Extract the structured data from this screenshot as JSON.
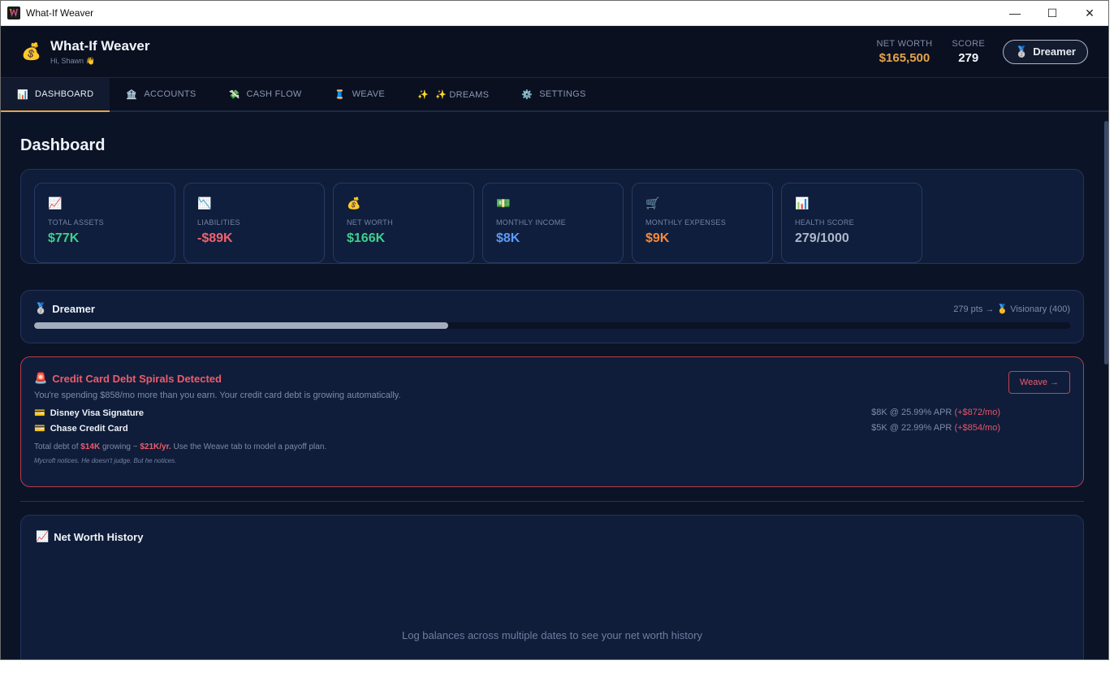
{
  "window": {
    "title": "What-If Weaver",
    "minimize": "—",
    "maximize": "☐",
    "close": "✕"
  },
  "header": {
    "logo_emoji": "💰",
    "app_name": "What-If Weaver",
    "greeting": "Hi, Shawn 👋",
    "net_worth_label": "NET WORTH",
    "net_worth_value": "$165,500",
    "score_label": "SCORE",
    "score_value": "279",
    "rank_emoji": "🥈",
    "rank_label": "Dreamer"
  },
  "nav": {
    "tabs": [
      {
        "icon": "📊",
        "label": "DASHBOARD"
      },
      {
        "icon": "🏦",
        "label": "ACCOUNTS"
      },
      {
        "icon": "💸",
        "label": "CASH FLOW"
      },
      {
        "icon": "🧵",
        "label": "WEAVE"
      },
      {
        "icon": "✨",
        "label": "✨ DREAMS"
      },
      {
        "icon": "⚙️",
        "label": "SETTINGS"
      }
    ]
  },
  "page": {
    "title": "Dashboard"
  },
  "stats": [
    {
      "icon": "📈",
      "label": "TOTAL ASSETS",
      "value": "$77K",
      "color": "#3ecf8e"
    },
    {
      "icon": "📉",
      "label": "LIABILITIES",
      "value": "-$89K",
      "color": "#f0616f"
    },
    {
      "icon": "💰",
      "label": "NET WORTH",
      "value": "$166K",
      "color": "#3ecf8e"
    },
    {
      "icon": "💵",
      "label": "MONTHLY INCOME",
      "value": "$8K",
      "color": "#5b9cf6"
    },
    {
      "icon": "🛒",
      "label": "MONTHLY EXPENSES",
      "value": "$9K",
      "color": "#f58a3c"
    },
    {
      "icon": "📊",
      "label": "HEALTH SCORE",
      "value": "279/1000",
      "color": "#aeb7c9"
    }
  ],
  "rank": {
    "icon": "🥈",
    "title": "Dreamer",
    "next": "279 pts → 🥇 Visionary (400)",
    "progress_fraction": 0.4
  },
  "alert": {
    "icon": "🚨",
    "title": "Credit Card Debt Spirals Detected",
    "subtitle": "You're spending $858/mo more than you earn. Your credit card debt is growing automatically.",
    "button": "Weave →",
    "debts": [
      {
        "icon": "💳",
        "name": "Disney Visa Signature",
        "info": "$8K @ 25.99% APR",
        "growth": "(+$872/mo)"
      },
      {
        "icon": "💳",
        "name": "Chase Credit Card",
        "info": "$5K @ 22.99% APR",
        "growth": "(+$854/mo)"
      }
    ],
    "total_prefix": "Total debt of",
    "total_amount": "$14K",
    "total_mid": "growing ~",
    "total_growth": "$21K/yr.",
    "total_suffix": "Use the Weave tab to model a payoff plan.",
    "note": "Mycroft notices. He doesn't judge. But he notices."
  },
  "history": {
    "icon": "📈",
    "title": "Net Worth History",
    "empty": "Log balances across multiple dates to see your net worth history"
  },
  "colors": {
    "gold": "#e6a24a",
    "green": "#3ecf8e",
    "red": "#ef5b6a"
  }
}
